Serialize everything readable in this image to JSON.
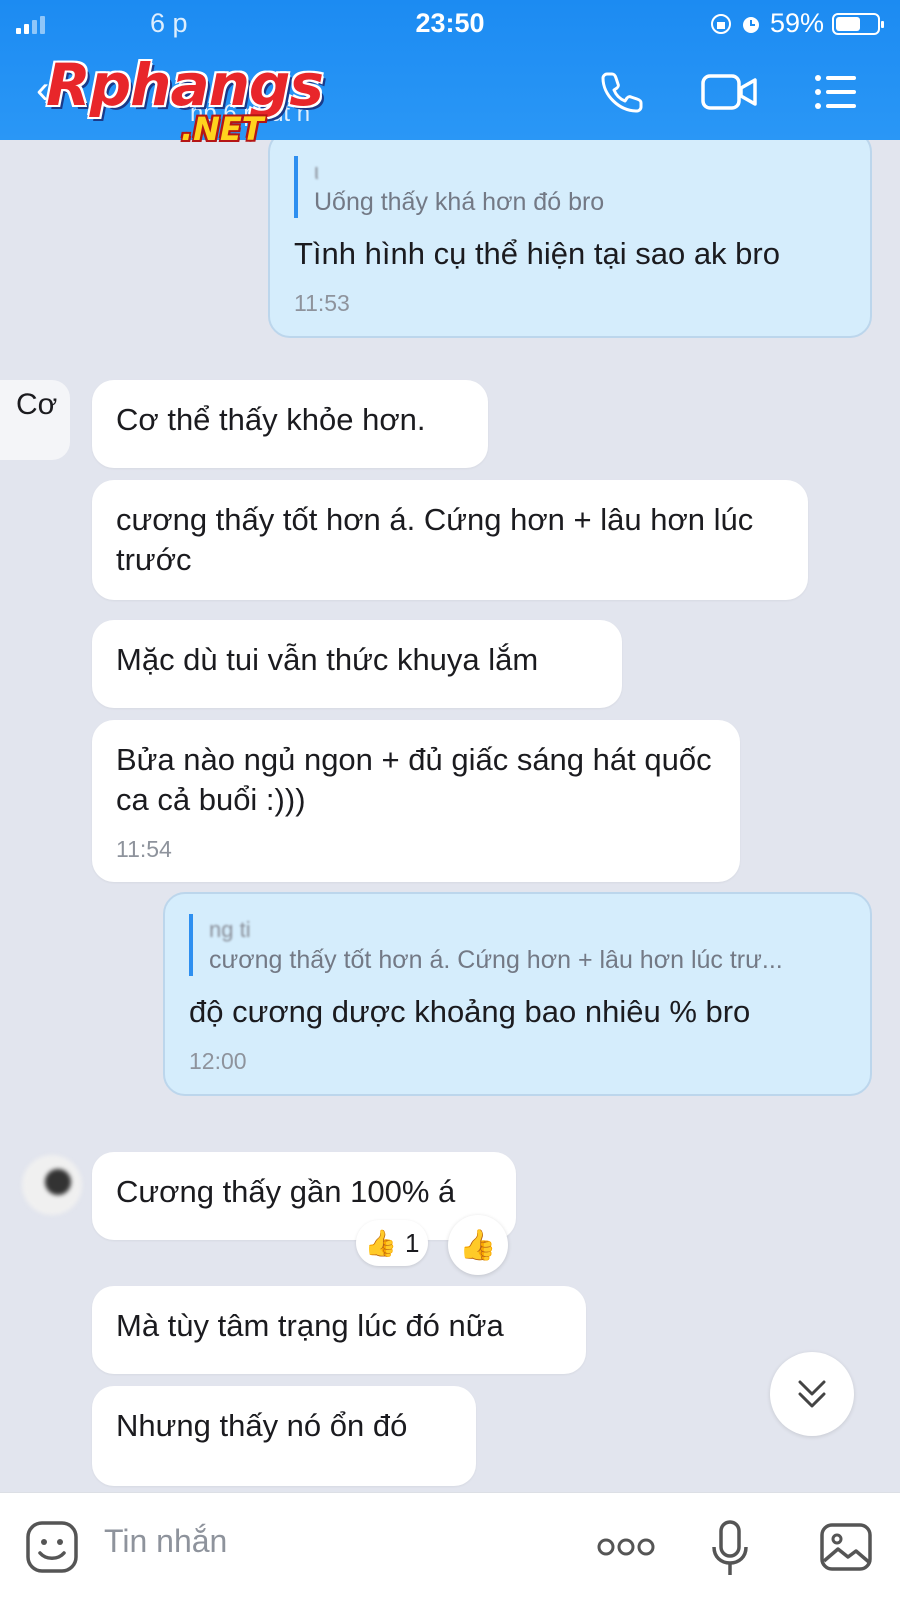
{
  "status_bar": {
    "carrier": "6 p",
    "time": "23:50",
    "battery_percent": "59%",
    "battery_level": 0.59
  },
  "header": {
    "subtitle": "np 6 phút h",
    "watermark_main": "Rphangs",
    "watermark_sub": ".NET",
    "icons": [
      "phone-icon",
      "video-icon",
      "menu-icon"
    ]
  },
  "messages": [
    {
      "direction": "out",
      "quote_name": "ι",
      "quote_text": "Uống thấy khá hơn đó bro",
      "text": "Tình hình cụ thể hiện tại sao ak bro",
      "time": "11:53"
    },
    {
      "direction": "in",
      "text": "Cơ thể thấy khỏe hơn."
    },
    {
      "direction": "in",
      "text": "cương thấy tốt hơn á. Cứng hơn + lâu hơn lúc trước"
    },
    {
      "direction": "in",
      "text": "Mặc dù tui vẫn thức khuya lắm"
    },
    {
      "direction": "in",
      "text": "Bửa nào ngủ ngon + đủ giấc sáng hát quốc ca cả buổi :)))",
      "time": "11:54"
    },
    {
      "direction": "out",
      "quote_name": "ng ti",
      "quote_text": "cương thấy tốt hơn á. Cứng hơn + lâu hơn lúc trư...",
      "text": "độ cương dược khoảng bao nhiêu % bro",
      "time": "12:00"
    },
    {
      "direction": "in",
      "text": "Cương thấy gần 100% á",
      "reaction_count": "1"
    },
    {
      "direction": "in",
      "text": "Mà tùy tâm trạng lúc đó nữa"
    },
    {
      "direction": "in",
      "text": "Nhưng thấy nó ổn đó"
    }
  ],
  "partial_avatar_text": "Cơ",
  "input": {
    "placeholder": "Tin nhắn",
    "icons": [
      "sticker-icon",
      "more-icon",
      "microphone-icon",
      "image-icon"
    ]
  },
  "colors": {
    "header_blue": "#1c8bf2",
    "outgoing_bubble": "#d5edfc",
    "incoming_bubble": "#ffffff",
    "background": "#e2e5ee",
    "accent": "#2d8ff0"
  }
}
